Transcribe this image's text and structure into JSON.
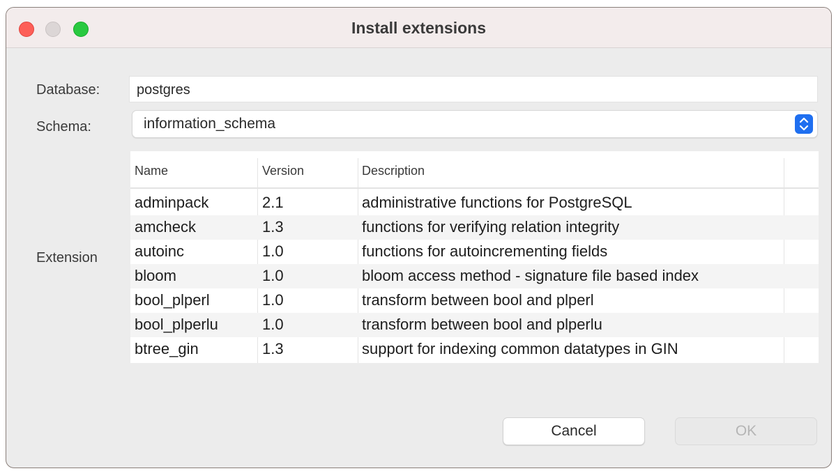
{
  "window": {
    "title": "Install extensions"
  },
  "form": {
    "database_label": "Database:",
    "database_value": "postgres",
    "schema_label": "Schema:",
    "schema_value": "information_schema",
    "extension_label": "Extension"
  },
  "table": {
    "columns": [
      "Name",
      "Version",
      "Description"
    ],
    "rows": [
      {
        "name": "adminpack",
        "version": "2.1",
        "description": "administrative functions for PostgreSQL"
      },
      {
        "name": "amcheck",
        "version": "1.3",
        "description": "functions for verifying relation integrity"
      },
      {
        "name": "autoinc",
        "version": "1.0",
        "description": "functions for autoincrementing fields"
      },
      {
        "name": "bloom",
        "version": "1.0",
        "description": "bloom access method - signature file based index"
      },
      {
        "name": "bool_plperl",
        "version": "1.0",
        "description": "transform between bool and plperl"
      },
      {
        "name": "bool_plperlu",
        "version": "1.0",
        "description": "transform between bool and plperlu"
      },
      {
        "name": "btree_gin",
        "version": "1.3",
        "description": "support for indexing common datatypes in GIN"
      }
    ]
  },
  "buttons": {
    "cancel_label": "Cancel",
    "ok_label": "OK"
  },
  "colors": {
    "close": "#fd5f58",
    "minimize_disabled": "#dcd6d6",
    "zoom": "#29c940",
    "select_accent": "#1f6ff0",
    "ok_disabled_text": "#b5b5b5"
  },
  "icons": {
    "close": "close-icon",
    "minimize": "minimize-icon",
    "zoom": "zoom-icon",
    "select_stepper": "chevron-up-down-icon"
  }
}
